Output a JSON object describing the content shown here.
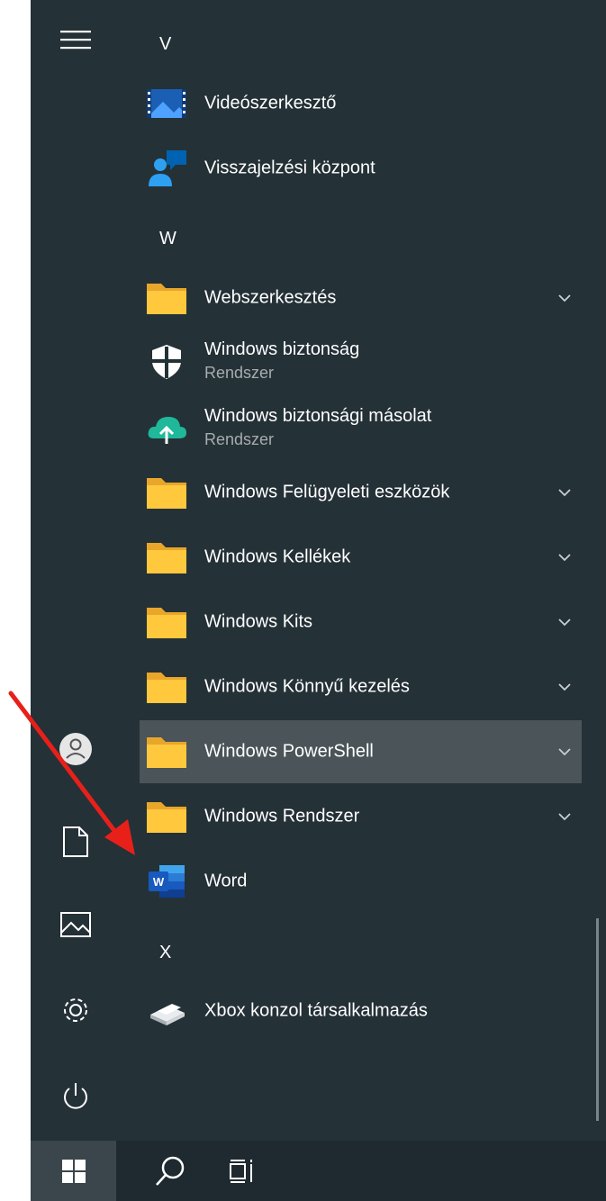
{
  "sections": {
    "v": "V",
    "w": "W",
    "x": "X"
  },
  "apps": {
    "videoeditor": {
      "name": "Videószerkesztő"
    },
    "feedback": {
      "name": "Visszajelzési központ"
    },
    "webedit": {
      "name": "Webszerkesztés"
    },
    "winsecurity": {
      "name": "Windows biztonság",
      "sub": "Rendszer"
    },
    "winbackup": {
      "name": "Windows biztonsági másolat",
      "sub": "Rendszer"
    },
    "winadmin": {
      "name": "Windows Felügyeleti eszközök"
    },
    "winaccessories": {
      "name": "Windows Kellékek"
    },
    "winkits": {
      "name": "Windows Kits"
    },
    "wineaseofaccess": {
      "name": "Windows Könnyű kezelés"
    },
    "winpowershell": {
      "name": "Windows PowerShell"
    },
    "winsystem": {
      "name": "Windows Rendszer"
    },
    "word": {
      "name": "Word"
    },
    "xbox": {
      "name": "Xbox konzol társalkalmazás"
    }
  },
  "icons": {
    "menu": "hamburger-menu-icon",
    "user": "user-icon",
    "documents": "document-icon",
    "pictures": "pictures-icon",
    "settings": "gear-icon",
    "power": "power-icon",
    "windows": "windows-logo-icon",
    "search": "search-icon",
    "taskview": "task-view-icon",
    "folder": "folder-icon",
    "chevron": "chevron-down-icon"
  },
  "colors": {
    "menu_bg": "#243137",
    "taskbar_bg": "#1f2a30",
    "highlight_bg": "#4a5459",
    "folder_yellow": "#ffc83d",
    "annotation_arrow": "#e8201a"
  }
}
